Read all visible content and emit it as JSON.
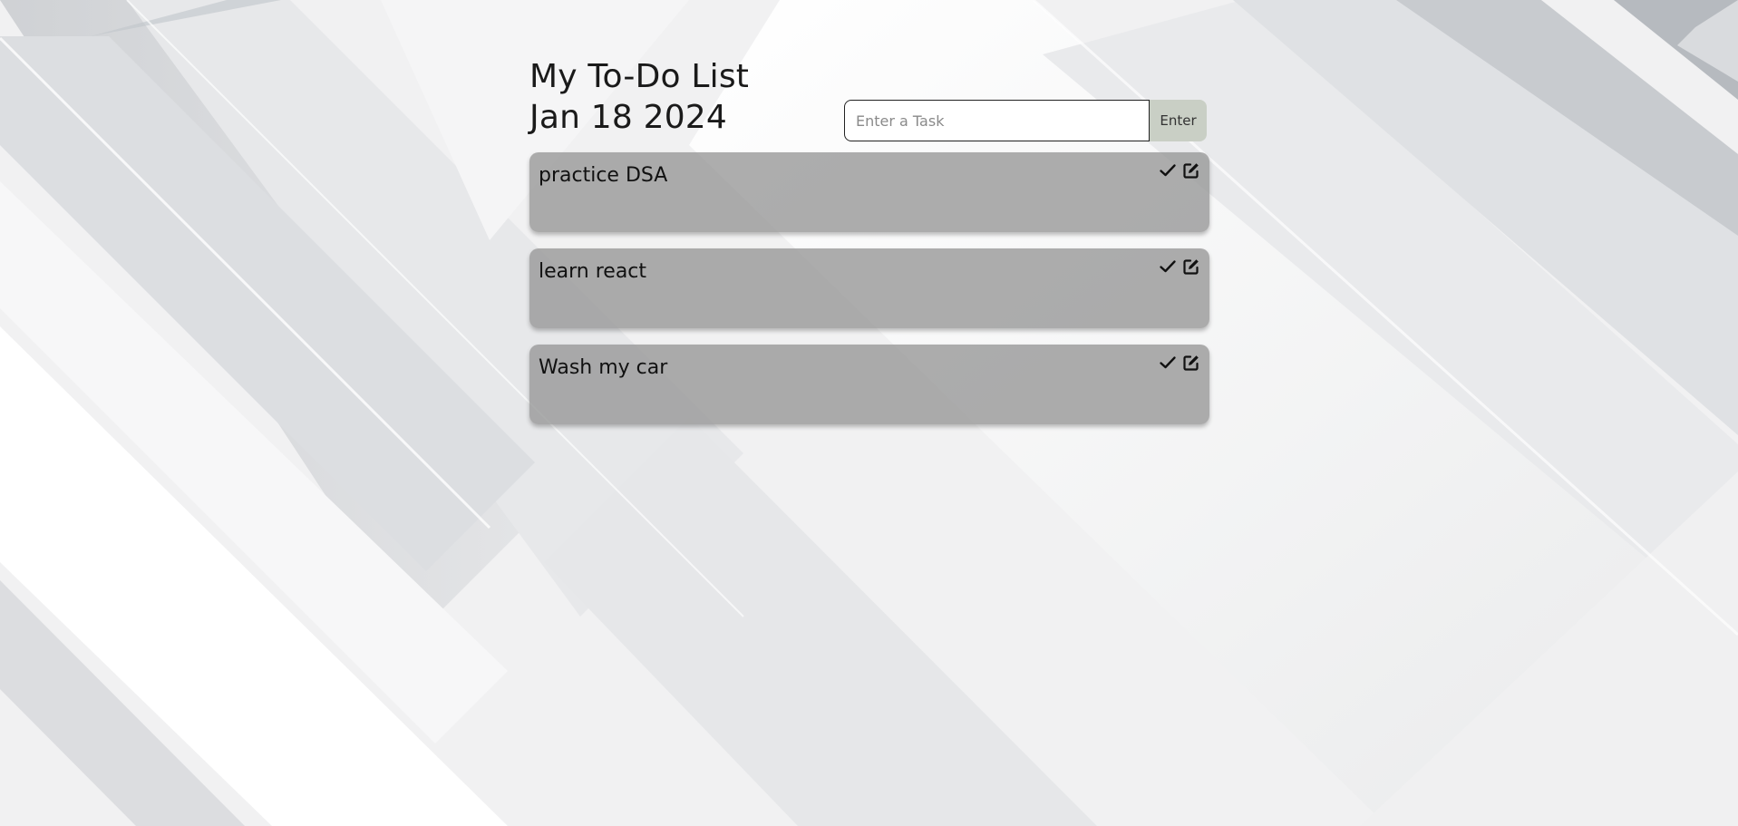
{
  "header": {
    "title": "My To-Do List",
    "date": "Jan 18 2024"
  },
  "task_input": {
    "placeholder": "Enter a Task",
    "value": ""
  },
  "enter_button": {
    "label": "Enter"
  },
  "tasks": [
    {
      "text": "practice DSA"
    },
    {
      "text": "learn react"
    },
    {
      "text": "Wash my car"
    }
  ],
  "icons": {
    "complete": "check-icon",
    "edit": "edit-icon"
  },
  "colors": {
    "card_background": "#969696",
    "enter_button_background": "#c9cfc5",
    "text": "#111111"
  }
}
